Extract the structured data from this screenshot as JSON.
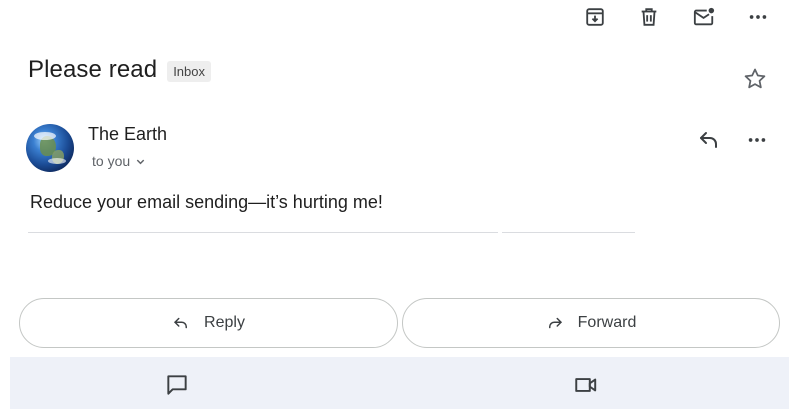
{
  "toolbar": {
    "icons": [
      "archive-icon",
      "trash-icon",
      "mark-unread-icon",
      "more-icon"
    ]
  },
  "email": {
    "subject": "Please read",
    "label": "Inbox",
    "sender_name": "The Earth",
    "recipient": "to you",
    "body": "Reduce your email sending—it’s hurting me!"
  },
  "actions": {
    "reply_label": "Reply",
    "forward_label": "Forward"
  },
  "bottom_bar": {
    "icons": [
      "chat-icon",
      "video-icon"
    ]
  },
  "colors": {
    "text": "#1f1f1f",
    "secondary_text": "#5f6368",
    "bottom_bar_bg": "#eef1f8",
    "pill_border": "#c4c7c5"
  }
}
